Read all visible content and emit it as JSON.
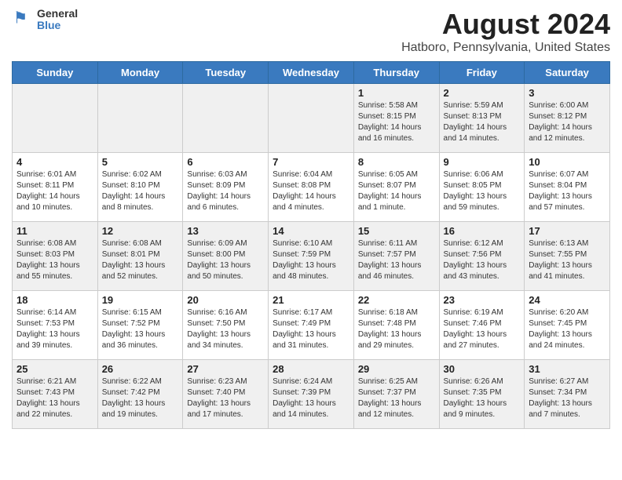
{
  "logo": {
    "general": "General",
    "blue": "Blue"
  },
  "title": "August 2024",
  "subtitle": "Hatboro, Pennsylvania, United States",
  "headers": [
    "Sunday",
    "Monday",
    "Tuesday",
    "Wednesday",
    "Thursday",
    "Friday",
    "Saturday"
  ],
  "rows": [
    [
      {
        "date": "",
        "info": ""
      },
      {
        "date": "",
        "info": ""
      },
      {
        "date": "",
        "info": ""
      },
      {
        "date": "",
        "info": ""
      },
      {
        "date": "1",
        "info": "Sunrise: 5:58 AM\nSunset: 8:15 PM\nDaylight: 14 hours\nand 16 minutes."
      },
      {
        "date": "2",
        "info": "Sunrise: 5:59 AM\nSunset: 8:13 PM\nDaylight: 14 hours\nand 14 minutes."
      },
      {
        "date": "3",
        "info": "Sunrise: 6:00 AM\nSunset: 8:12 PM\nDaylight: 14 hours\nand 12 minutes."
      }
    ],
    [
      {
        "date": "4",
        "info": "Sunrise: 6:01 AM\nSunset: 8:11 PM\nDaylight: 14 hours\nand 10 minutes."
      },
      {
        "date": "5",
        "info": "Sunrise: 6:02 AM\nSunset: 8:10 PM\nDaylight: 14 hours\nand 8 minutes."
      },
      {
        "date": "6",
        "info": "Sunrise: 6:03 AM\nSunset: 8:09 PM\nDaylight: 14 hours\nand 6 minutes."
      },
      {
        "date": "7",
        "info": "Sunrise: 6:04 AM\nSunset: 8:08 PM\nDaylight: 14 hours\nand 4 minutes."
      },
      {
        "date": "8",
        "info": "Sunrise: 6:05 AM\nSunset: 8:07 PM\nDaylight: 14 hours\nand 1 minute."
      },
      {
        "date": "9",
        "info": "Sunrise: 6:06 AM\nSunset: 8:05 PM\nDaylight: 13 hours\nand 59 minutes."
      },
      {
        "date": "10",
        "info": "Sunrise: 6:07 AM\nSunset: 8:04 PM\nDaylight: 13 hours\nand 57 minutes."
      }
    ],
    [
      {
        "date": "11",
        "info": "Sunrise: 6:08 AM\nSunset: 8:03 PM\nDaylight: 13 hours\nand 55 minutes."
      },
      {
        "date": "12",
        "info": "Sunrise: 6:08 AM\nSunset: 8:01 PM\nDaylight: 13 hours\nand 52 minutes."
      },
      {
        "date": "13",
        "info": "Sunrise: 6:09 AM\nSunset: 8:00 PM\nDaylight: 13 hours\nand 50 minutes."
      },
      {
        "date": "14",
        "info": "Sunrise: 6:10 AM\nSunset: 7:59 PM\nDaylight: 13 hours\nand 48 minutes."
      },
      {
        "date": "15",
        "info": "Sunrise: 6:11 AM\nSunset: 7:57 PM\nDaylight: 13 hours\nand 46 minutes."
      },
      {
        "date": "16",
        "info": "Sunrise: 6:12 AM\nSunset: 7:56 PM\nDaylight: 13 hours\nand 43 minutes."
      },
      {
        "date": "17",
        "info": "Sunrise: 6:13 AM\nSunset: 7:55 PM\nDaylight: 13 hours\nand 41 minutes."
      }
    ],
    [
      {
        "date": "18",
        "info": "Sunrise: 6:14 AM\nSunset: 7:53 PM\nDaylight: 13 hours\nand 39 minutes."
      },
      {
        "date": "19",
        "info": "Sunrise: 6:15 AM\nSunset: 7:52 PM\nDaylight: 13 hours\nand 36 minutes."
      },
      {
        "date": "20",
        "info": "Sunrise: 6:16 AM\nSunset: 7:50 PM\nDaylight: 13 hours\nand 34 minutes."
      },
      {
        "date": "21",
        "info": "Sunrise: 6:17 AM\nSunset: 7:49 PM\nDaylight: 13 hours\nand 31 minutes."
      },
      {
        "date": "22",
        "info": "Sunrise: 6:18 AM\nSunset: 7:48 PM\nDaylight: 13 hours\nand 29 minutes."
      },
      {
        "date": "23",
        "info": "Sunrise: 6:19 AM\nSunset: 7:46 PM\nDaylight: 13 hours\nand 27 minutes."
      },
      {
        "date": "24",
        "info": "Sunrise: 6:20 AM\nSunset: 7:45 PM\nDaylight: 13 hours\nand 24 minutes."
      }
    ],
    [
      {
        "date": "25",
        "info": "Sunrise: 6:21 AM\nSunset: 7:43 PM\nDaylight: 13 hours\nand 22 minutes."
      },
      {
        "date": "26",
        "info": "Sunrise: 6:22 AM\nSunset: 7:42 PM\nDaylight: 13 hours\nand 19 minutes."
      },
      {
        "date": "27",
        "info": "Sunrise: 6:23 AM\nSunset: 7:40 PM\nDaylight: 13 hours\nand 17 minutes."
      },
      {
        "date": "28",
        "info": "Sunrise: 6:24 AM\nSunset: 7:39 PM\nDaylight: 13 hours\nand 14 minutes."
      },
      {
        "date": "29",
        "info": "Sunrise: 6:25 AM\nSunset: 7:37 PM\nDaylight: 13 hours\nand 12 minutes."
      },
      {
        "date": "30",
        "info": "Sunrise: 6:26 AM\nSunset: 7:35 PM\nDaylight: 13 hours\nand 9 minutes."
      },
      {
        "date": "31",
        "info": "Sunrise: 6:27 AM\nSunset: 7:34 PM\nDaylight: 13 hours\nand 7 minutes."
      }
    ]
  ],
  "grayRows": [
    0,
    2,
    4
  ]
}
